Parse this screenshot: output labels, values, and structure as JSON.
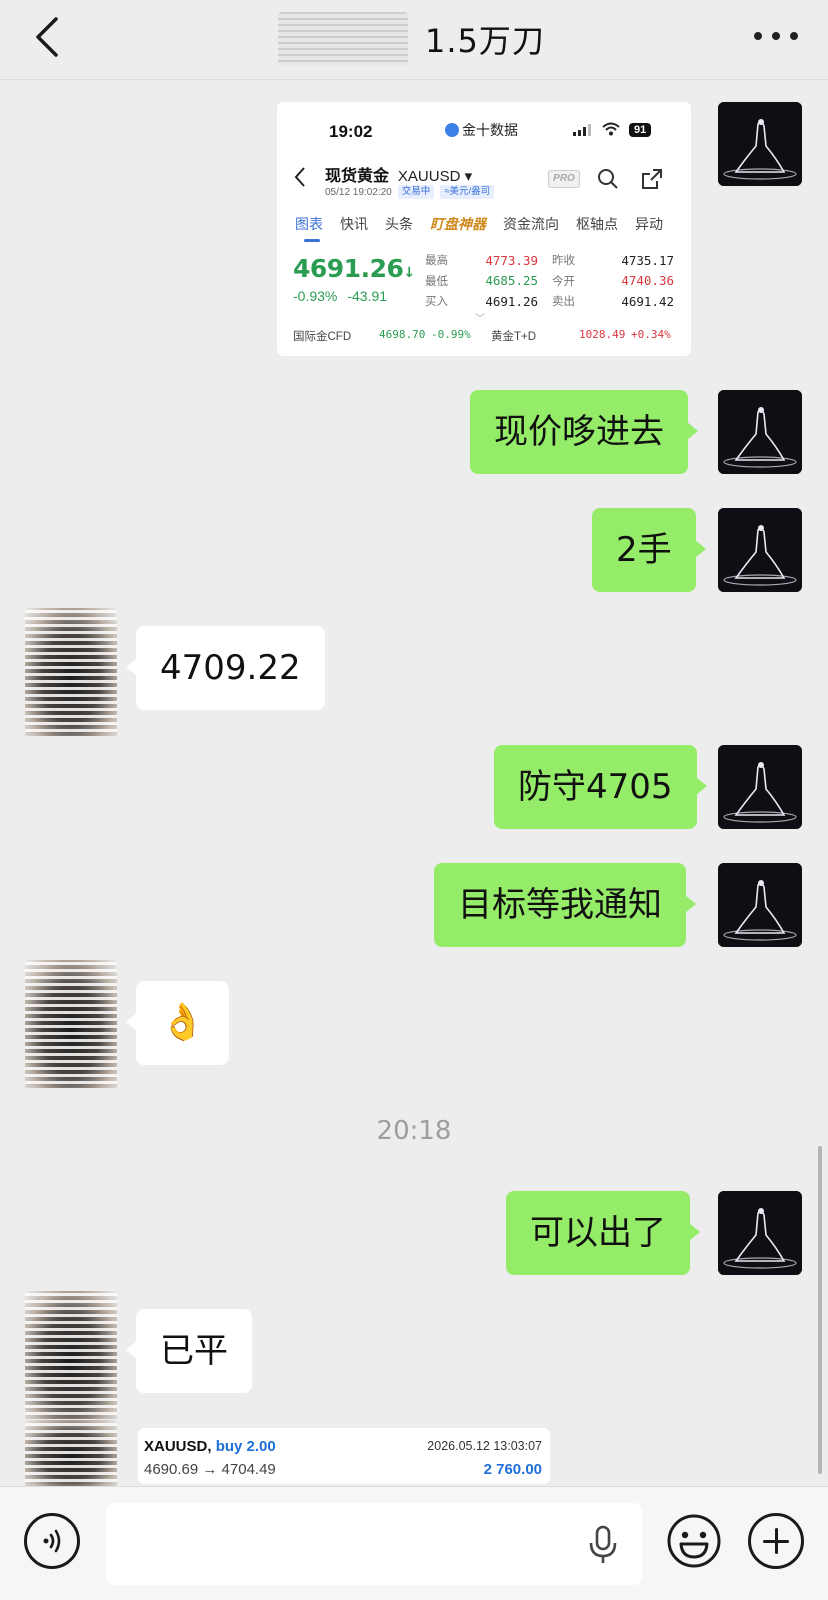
{
  "header": {
    "title": "1.5万刀"
  },
  "quote_card": {
    "status_time": "19:02",
    "app_name": "金十数据",
    "battery": "91",
    "instrument_name": "现货黄金",
    "symbol": "XAUUSD",
    "datetime": "05/12 19:02:20",
    "status_tag": "交易中",
    "unit_tag": "≈美元/盎司",
    "pro_badge": "PRO",
    "tabs": [
      "图表",
      "快讯",
      "头条",
      "盯盘神器",
      "资金流向",
      "枢轴点",
      "异动"
    ],
    "price": "4691.26",
    "price_arrow": "↓",
    "change_pct": "-0.93%",
    "change_abs": "-43.91",
    "stats": [
      {
        "label": "最高",
        "value": "4773.39",
        "label2": "昨收",
        "value2": "4735.17"
      },
      {
        "label": "最低",
        "value": "4685.25",
        "label2": "今开",
        "value2": "4740.36"
      },
      {
        "label": "买入",
        "value": "4691.26",
        "label2": "卖出",
        "value2": "4691.42"
      }
    ],
    "footer": {
      "left_name": "国际金CFD",
      "left_value": "4698.70",
      "left_change": "-0.99%",
      "right_name": "黄金T+D",
      "right_value": "1028.49",
      "right_change": "+0.34%"
    }
  },
  "messages": {
    "m1": "现价哆进去",
    "m2": "2手",
    "m3": "4709.22",
    "m4": "防守4705",
    "m5": "目标等我通知",
    "m6": "👌",
    "time_divider": "20:18",
    "m7": "可以出了",
    "m8": "已平"
  },
  "trade_card": {
    "symbol": "XAUUSD,",
    "direction": "buy 2.00",
    "datetime": "2026.05.12 13:03:07",
    "prices": "4690.69 → 4704.49",
    "profit": "2 760.00"
  },
  "input_bar": {
    "text_value": ""
  },
  "colors": {
    "bubble_mine": "#95ec69",
    "bubble_theirs": "#ffffff",
    "chat_bg": "#ededed",
    "quote_up_green": "#2a9d52",
    "quote_red": "#d9363e",
    "link_blue": "#1e6fd9"
  },
  "icons": [
    "chevron-left-icon",
    "more-icon",
    "voice-icon",
    "microphone-icon",
    "emoji-icon",
    "plus-icon"
  ]
}
